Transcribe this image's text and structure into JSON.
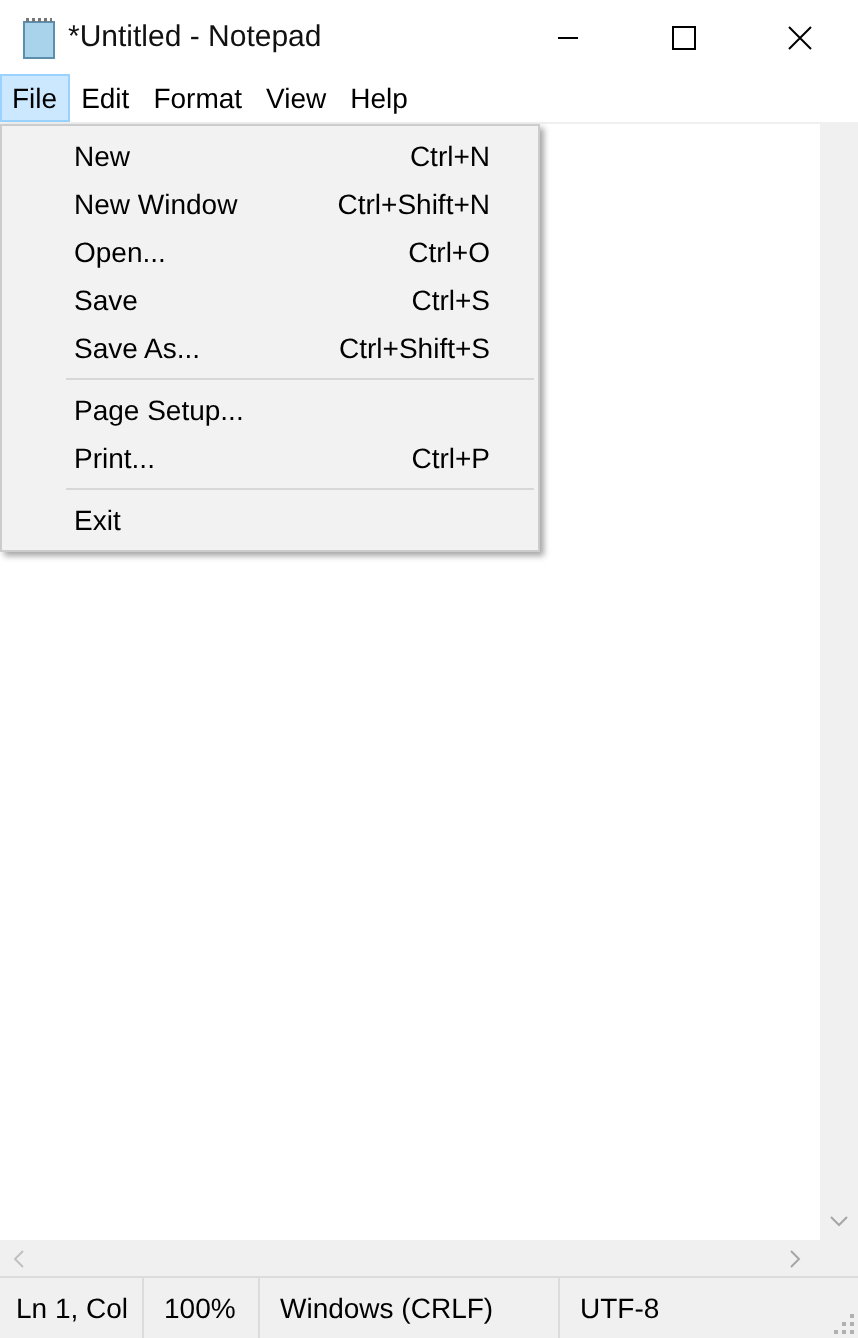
{
  "window": {
    "title": "*Untitled - Notepad"
  },
  "menu_bar": [
    {
      "label": "File",
      "selected": true
    },
    {
      "label": "Edit",
      "selected": false
    },
    {
      "label": "Format",
      "selected": false
    },
    {
      "label": "View",
      "selected": false
    },
    {
      "label": "Help",
      "selected": false
    }
  ],
  "file_menu": [
    {
      "kind": "item",
      "label": "New",
      "shortcut": "Ctrl+N"
    },
    {
      "kind": "item",
      "label": "New Window",
      "shortcut": "Ctrl+Shift+N"
    },
    {
      "kind": "item",
      "label": "Open...",
      "shortcut": "Ctrl+O"
    },
    {
      "kind": "item",
      "label": "Save",
      "shortcut": "Ctrl+S"
    },
    {
      "kind": "item",
      "label": "Save As...",
      "shortcut": "Ctrl+Shift+S"
    },
    {
      "kind": "separator"
    },
    {
      "kind": "item",
      "label": "Page Setup..."
    },
    {
      "kind": "item",
      "label": "Print...",
      "shortcut": "Ctrl+P"
    },
    {
      "kind": "separator"
    },
    {
      "kind": "item",
      "label": "Exit"
    }
  ],
  "status_bar": [
    "Ln 1, Col",
    "100%",
    "Windows (CRLF)",
    "UTF-8"
  ]
}
